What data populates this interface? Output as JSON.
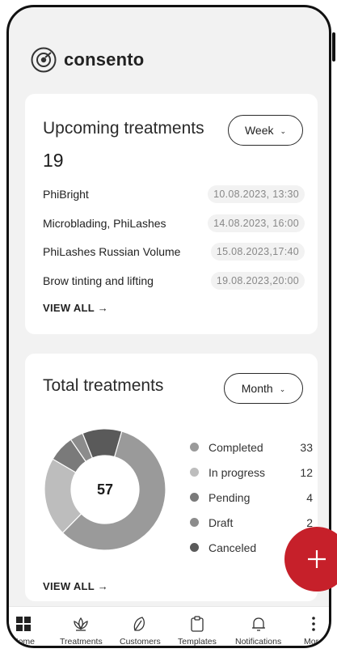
{
  "app": {
    "logo_text": "consento"
  },
  "upcoming": {
    "title": "Upcoming treatments",
    "period_label": "Week",
    "count": "19",
    "items": [
      {
        "name": "PhiBright",
        "date": "10.08.2023, 13:30"
      },
      {
        "name": "Microblading, PhiLashes",
        "date": "14.08.2023, 16:00"
      },
      {
        "name": "PhiLashes Russian Volume",
        "date": "15.08.2023,17:40"
      },
      {
        "name": "Brow tinting and lifting",
        "date": "19.08.2023,20:00"
      }
    ],
    "view_all": "VIEW ALL →"
  },
  "total": {
    "title": "Total treatments",
    "period_label": "Month",
    "center_value": "57",
    "view_all": "VIEW ALL →"
  },
  "chart_data": {
    "type": "pie",
    "categories": [
      "Completed",
      "In progress",
      "Pending",
      "Draft",
      "Canceled"
    ],
    "values": [
      33,
      12,
      4,
      2,
      6
    ],
    "colors": [
      "#9a9a9a",
      "#bdbdbd",
      "#7a7a7a",
      "#8c8c8c",
      "#5a5a5a"
    ],
    "legend": "right"
  },
  "fab": {
    "icon": "plus-icon",
    "color": "#c6202a"
  },
  "nav": [
    {
      "label": "Home",
      "icon": "home-icon"
    },
    {
      "label": "Treatments",
      "icon": "lotus-icon"
    },
    {
      "label": "Customers",
      "icon": "leaf-icon"
    },
    {
      "label": "Templates",
      "icon": "clipboard-icon"
    },
    {
      "label": "Notifications",
      "icon": "bell-icon"
    },
    {
      "label": "More",
      "icon": "more-icon"
    }
  ]
}
